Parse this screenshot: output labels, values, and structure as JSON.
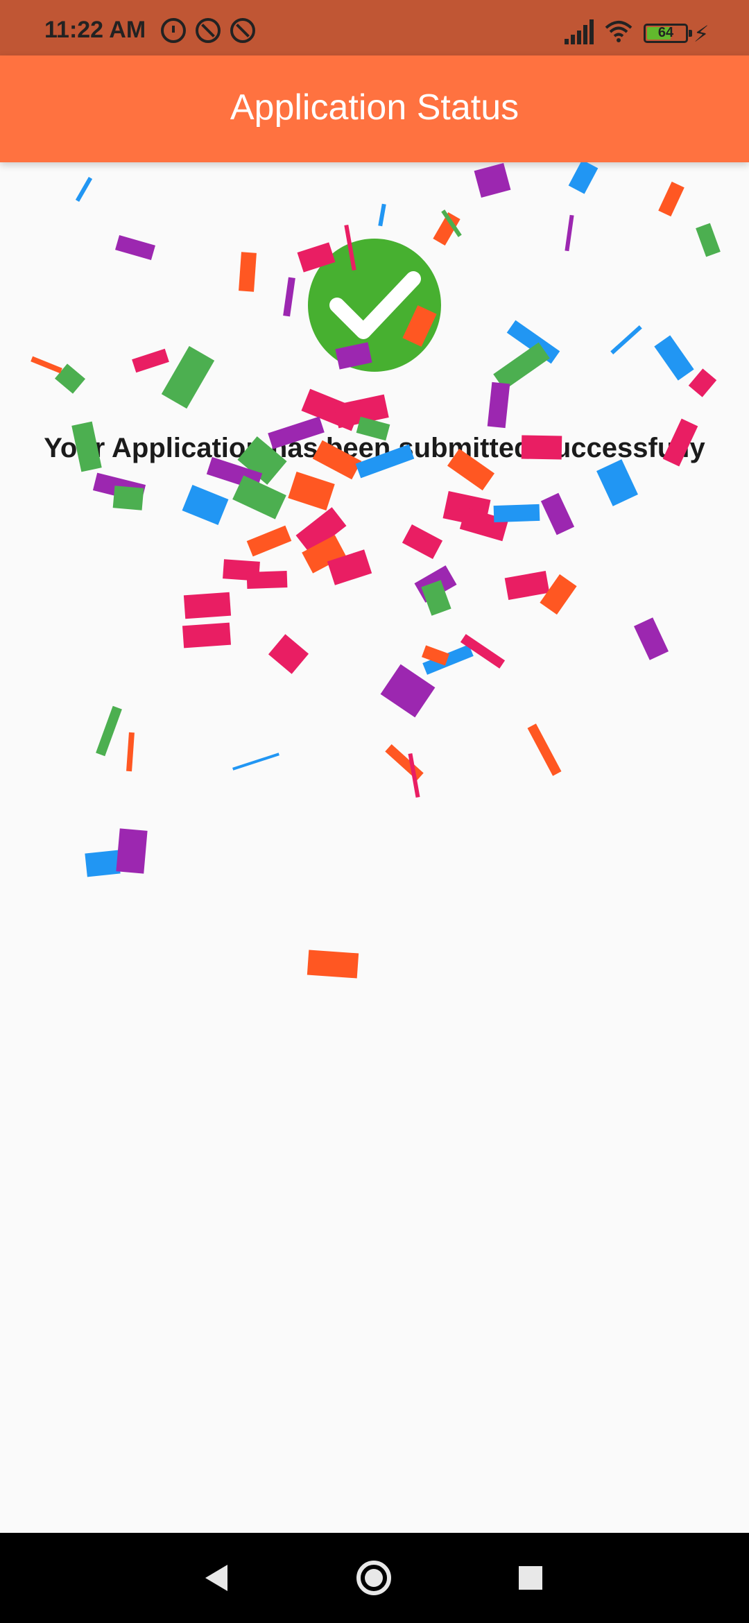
{
  "status_bar": {
    "time": "11:22 AM",
    "battery_level": "64",
    "icons": [
      "alarm-icon",
      "do-not-disturb-icon",
      "do-not-disturb-icon",
      "signal-strength-icon",
      "wifi-icon",
      "battery-icon",
      "charging-icon"
    ]
  },
  "app_bar": {
    "title": "Application Status"
  },
  "main": {
    "status_icon": "success-check-icon",
    "message": "Your Application has been submitted successfully"
  },
  "nav_bar": {
    "buttons": [
      "back-icon",
      "home-icon",
      "recents-icon"
    ]
  },
  "colors": {
    "status_bar": "#c05634",
    "app_bar": "#ff7240",
    "success_green": "#47b030",
    "background": "#fafafa",
    "confetti": [
      "#e91e63",
      "#2196f3",
      "#4caf50",
      "#9c27b0",
      "#ff5722"
    ]
  }
}
